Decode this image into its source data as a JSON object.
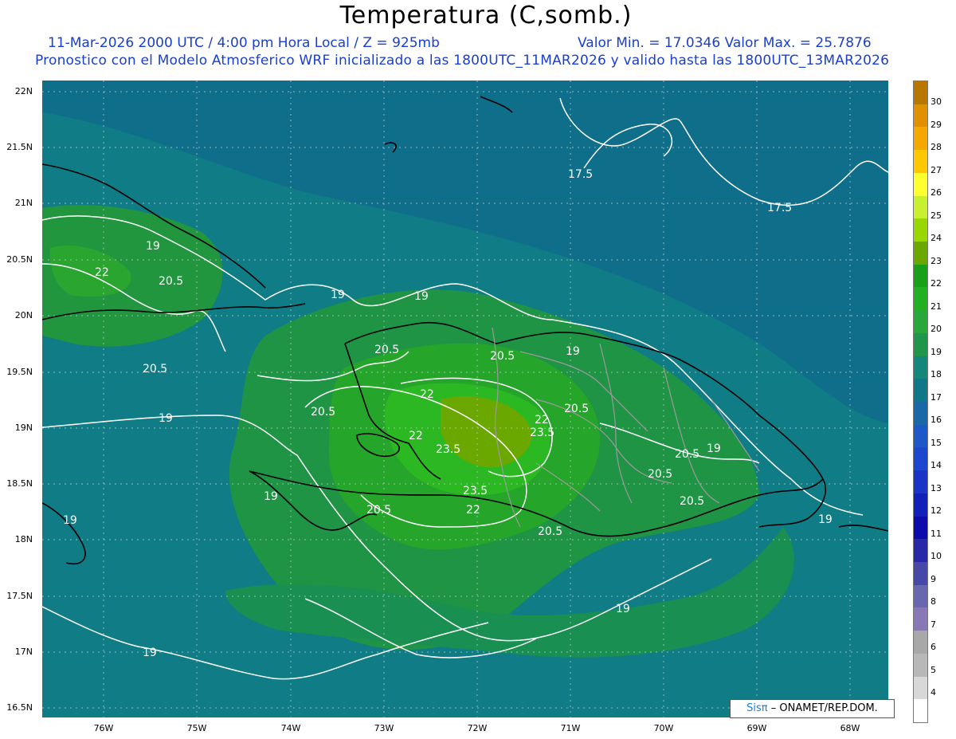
{
  "header": {
    "title": "Temperatura (C,somb.)",
    "datetime_line": "11-Mar-2026  2000 UTC / 4:00 pm Hora Local / Z = 925mb",
    "minmax_line": "Valor Min. = 17.0346  Valor Max. = 25.7876",
    "model_line": "Pronostico con el Modelo Atmosferico WRF inicializado a las 1800UTC_11MAR2026 y valido hasta las  1800UTC_13MAR2026"
  },
  "axes": {
    "lat_labels": [
      "22N",
      "21.5N",
      "21N",
      "20.5N",
      "20N",
      "19.5N",
      "19N",
      "18.5N",
      "18N",
      "17.5N",
      "17N",
      "16.5N"
    ],
    "lon_labels": [
      "76W",
      "75W",
      "74W",
      "73W",
      "72W",
      "71W",
      "70W",
      "69W",
      "68W"
    ]
  },
  "contour_labels": [
    {
      "text": "17.5"
    },
    {
      "text": "17.5"
    },
    {
      "text": "19"
    },
    {
      "text": "22"
    },
    {
      "text": "20.5"
    },
    {
      "text": "19"
    },
    {
      "text": "19"
    },
    {
      "text": "20.5"
    },
    {
      "text": "20.5"
    },
    {
      "text": "20.5"
    },
    {
      "text": "19"
    },
    {
      "text": "22"
    },
    {
      "text": "20.5"
    },
    {
      "text": "22"
    },
    {
      "text": "22"
    },
    {
      "text": "23.5"
    },
    {
      "text": "23.5"
    },
    {
      "text": "19"
    },
    {
      "text": "20.5"
    },
    {
      "text": "20.5"
    },
    {
      "text": "19"
    },
    {
      "text": "19"
    },
    {
      "text": "20.5"
    },
    {
      "text": "20.5"
    },
    {
      "text": "23.5"
    },
    {
      "text": "20.5"
    },
    {
      "text": "22"
    },
    {
      "text": "19"
    },
    {
      "text": "20.5"
    },
    {
      "text": "19"
    },
    {
      "text": "19"
    },
    {
      "text": "19"
    }
  ],
  "colorbar": {
    "labels": [
      "30",
      "29",
      "28",
      "27",
      "26",
      "25",
      "24",
      "23",
      "22",
      "21",
      "20",
      "19",
      "18",
      "17",
      "16",
      "15",
      "14",
      "13",
      "12",
      "11",
      "10",
      "9",
      "8",
      "7",
      "6",
      "5",
      "4"
    ],
    "colors": [
      "#b87800",
      "#e09000",
      "#f4a800",
      "#ffc800",
      "#ffff30",
      "#c8f030",
      "#98d800",
      "#6aa800",
      "#18a018",
      "#22b022",
      "#28a838",
      "#20964a",
      "#13887a",
      "#0e7888",
      "#1a68a8",
      "#1c58c8",
      "#1c48d0",
      "#1a34c8",
      "#1020b8",
      "#0c0cac",
      "#2828a8",
      "#4848a8",
      "#6868b0",
      "#8878b8",
      "#a8a8a8",
      "#b8b8b8",
      "#d8d8d8",
      "#ffffff"
    ]
  },
  "credit": {
    "brand": "Sisπ",
    "text": "– ONAMET/REP.DOM."
  }
}
